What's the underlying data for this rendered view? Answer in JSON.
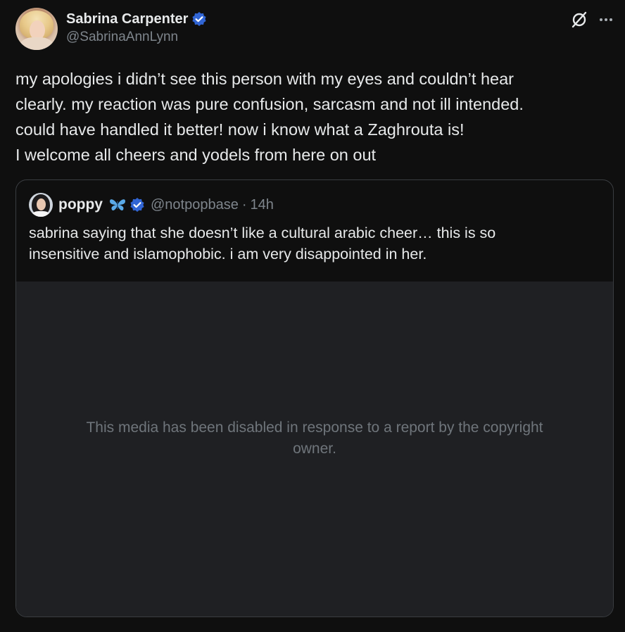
{
  "tweet": {
    "author": {
      "display_name": "Sabrina Carpenter",
      "handle": "@SabrinaAnnLynn"
    },
    "text_lines": [
      "my apologies i didn’t see this person with my eyes and couldn’t hear",
      "clearly. my reaction was pure confusion, sarcasm and not ill intended.",
      "could have handled it better! now i know what a Zaghrouta is!",
      "I welcome all cheers and yodels from here on out"
    ],
    "icons": {
      "verified": "verified-badge-icon",
      "actions": [
        "slash-circle-icon",
        "more-icon"
      ]
    }
  },
  "quote": {
    "author": {
      "display_name": "poppy",
      "emoji": "butterfly-icon",
      "handle": "@notpopbase",
      "separator": "·",
      "time": "14h"
    },
    "text_lines": [
      "sabrina saying that she doesn’t like a cultural arabic cheer… this is so",
      "insensitive and islamophobic. i am very disappointed in her."
    ],
    "media_notice_lines": [
      "This media has been disabled in response to a report by the copyright",
      "owner."
    ]
  },
  "colors": {
    "background": "#0f0f0f",
    "verified_blue": "#3165d4",
    "butterfly_blue": "#5aa9e6",
    "muted_text": "#7e858c",
    "media_bg": "#1f2023"
  }
}
